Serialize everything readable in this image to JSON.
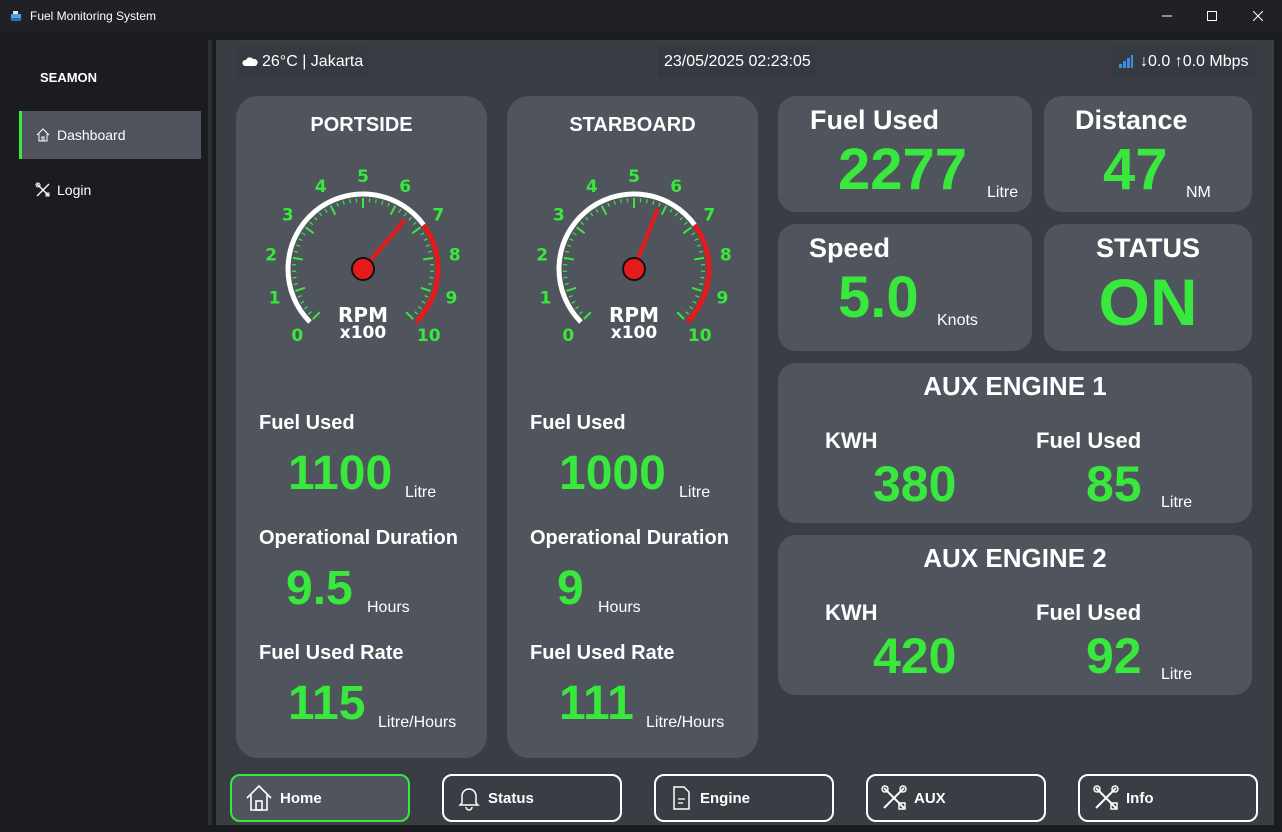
{
  "window": {
    "title": "Fuel Monitoring System"
  },
  "sidebar": {
    "brand": "SEAMON",
    "items": [
      {
        "label": "Dashboard",
        "icon": "home-icon",
        "active": true
      },
      {
        "label": "Login",
        "icon": "tools-icon",
        "active": false
      }
    ]
  },
  "topbar": {
    "weather": "26°C | Jakarta",
    "datetime": "23/05/2025 02:23:05",
    "network": "↓0.0 ↑0.0 Mbps"
  },
  "engines": [
    {
      "title": "PORTSIDE",
      "rpm_value": 6.5,
      "gauge_unit_1": "RPM",
      "gauge_unit_2": "x100",
      "fuel_used_label": "Fuel Used",
      "fuel_used": "1100",
      "fuel_used_unit": "Litre",
      "duration_label": "Operational Duration",
      "duration": "9.5",
      "duration_unit": "Hours",
      "rate_label": "Fuel Used Rate",
      "rate": "115",
      "rate_unit": "Litre/Hours"
    },
    {
      "title": "STARBOARD",
      "rpm_value": 5.8,
      "gauge_unit_1": "RPM",
      "gauge_unit_2": "x100",
      "fuel_used_label": "Fuel Used",
      "fuel_used": "1000",
      "fuel_used_unit": "Litre",
      "duration_label": "Operational Duration",
      "duration": "9",
      "duration_unit": "Hours",
      "rate_label": "Fuel Used Rate",
      "rate": "111",
      "rate_unit": "Litre/Hours"
    }
  ],
  "gauge": {
    "min": 0,
    "max": 10,
    "ticks": [
      "0",
      "1",
      "2",
      "3",
      "4",
      "5",
      "6",
      "7",
      "8",
      "9",
      "10"
    ],
    "redline_start": 7,
    "colors": {
      "arc": "#ffffff",
      "red": "#e31b1b",
      "tick": "#39e83c",
      "needle": "#e31b1b"
    }
  },
  "summary": {
    "fuel_used": {
      "label": "Fuel Used",
      "value": "2277",
      "unit": "Litre"
    },
    "distance": {
      "label": "Distance",
      "value": "47",
      "unit": "NM"
    },
    "speed": {
      "label": "Speed",
      "value": "5.0",
      "unit": "Knots"
    },
    "status": {
      "label": "STATUS",
      "value": "ON"
    }
  },
  "aux": [
    {
      "title": "AUX ENGINE 1",
      "kwh_label": "KWH",
      "kwh": "380",
      "fuel_label": "Fuel Used",
      "fuel": "85",
      "fuel_unit": "Litre"
    },
    {
      "title": "AUX ENGINE 2",
      "kwh_label": "KWH",
      "kwh": "420",
      "fuel_label": "Fuel Used",
      "fuel": "92",
      "fuel_unit": "Litre"
    }
  ],
  "bottom_nav": [
    {
      "label": "Home",
      "icon": "home-icon",
      "active": true
    },
    {
      "label": "Status",
      "icon": "bell-icon",
      "active": false
    },
    {
      "label": "Engine",
      "icon": "document-icon",
      "active": false
    },
    {
      "label": "AUX",
      "icon": "tools-icon",
      "active": false
    },
    {
      "label": "Info",
      "icon": "tools-icon",
      "active": false
    }
  ],
  "colors": {
    "accent": "#39e83c",
    "panel": "#50545c",
    "background": "#3a3d44"
  }
}
